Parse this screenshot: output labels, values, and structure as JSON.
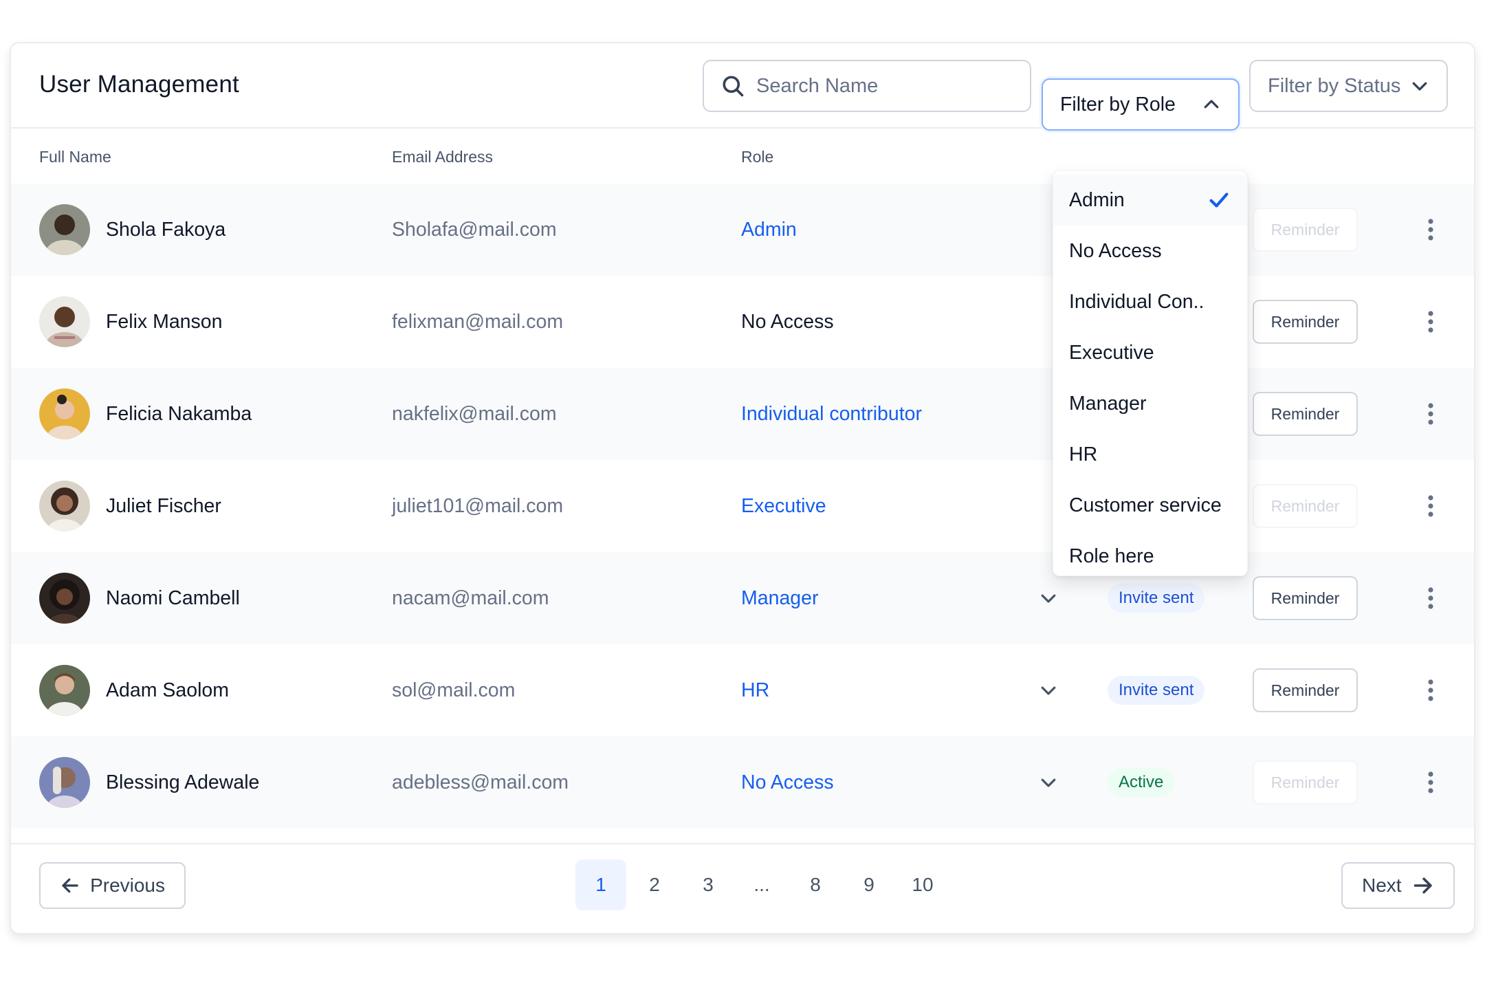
{
  "header": {
    "title": "User Management",
    "search_placeholder": "Search Name",
    "filter_role_label": "Filter by Role",
    "filter_status_label": "Filter by Status"
  },
  "table": {
    "columns": [
      "Full Name",
      "Email Address",
      "Role"
    ],
    "reminder_label": "Reminder",
    "rows": [
      {
        "name": "Shola Fakoya",
        "email": "Sholafa@mail.com",
        "role": "Admin",
        "status": "",
        "reminder_enabled": false
      },
      {
        "name": "Felix Manson",
        "email": "felixman@mail.com",
        "role": "No Access",
        "status": "",
        "reminder_enabled": true
      },
      {
        "name": "Felicia Nakamba",
        "email": "nakfelix@mail.com",
        "role": "Individual contributor",
        "status": "",
        "reminder_enabled": true
      },
      {
        "name": "Juliet Fischer",
        "email": "juliet101@mail.com",
        "role": "Executive",
        "status": "",
        "reminder_enabled": false
      },
      {
        "name": "Naomi Cambell",
        "email": "nacam@mail.com",
        "role": "Manager",
        "status": "Invite sent",
        "reminder_enabled": true
      },
      {
        "name": "Adam Saolom",
        "email": "sol@mail.com",
        "role": "HR",
        "status": "Invite sent",
        "reminder_enabled": true
      },
      {
        "name": "Blessing Adewale",
        "email": "adebless@mail.com",
        "role": "No Access",
        "status": "Active",
        "reminder_enabled": false
      }
    ]
  },
  "role_dropdown": {
    "options": [
      "Admin",
      "No Access",
      "Individual Con..",
      "Executive",
      "Manager",
      "HR",
      "Customer service",
      "Role here"
    ],
    "selected": "Admin"
  },
  "pagination": {
    "previous_label": "Previous",
    "next_label": "Next",
    "pages": [
      "1",
      "2",
      "3",
      "...",
      "8",
      "9",
      "10"
    ],
    "current": "1"
  },
  "colors": {
    "accent": "#155eef",
    "invite_badge_bg": "#eef4ff",
    "active_badge_bg": "#ecfdf3",
    "active_badge_text": "#067647"
  }
}
